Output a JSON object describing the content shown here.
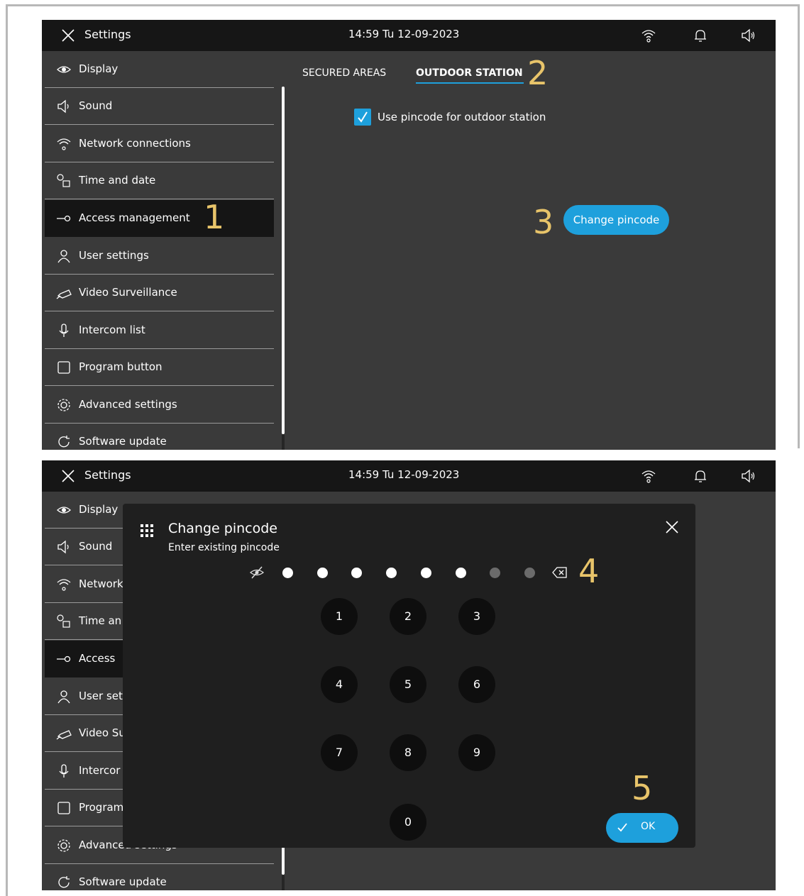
{
  "topbar": {
    "title": "Settings",
    "clock": "14:59  Tu 12-09-2023",
    "icons": [
      "close-icon",
      "wifi-icon",
      "bell-icon",
      "speaker-icon"
    ]
  },
  "sidebar": {
    "items": [
      {
        "label": "Display",
        "icon": "eye-icon"
      },
      {
        "label": "Sound",
        "icon": "speaker-icon"
      },
      {
        "label": "Network connections",
        "icon": "wifi-icon"
      },
      {
        "label": "Time and date",
        "icon": "clock-calendar-icon"
      },
      {
        "label": "Access  management",
        "icon": "key-icon",
        "active": true
      },
      {
        "label": "User settings",
        "icon": "user-icon"
      },
      {
        "label": "Video Surveillance",
        "icon": "camera-icon"
      },
      {
        "label": "Intercom list",
        "icon": "microphone-icon"
      },
      {
        "label": "Program button",
        "icon": "square-icon"
      },
      {
        "label": "Advanced settings",
        "icon": "gear-icon"
      },
      {
        "label": "Software update",
        "icon": "refresh-icon"
      }
    ],
    "items_dialog_view": [
      {
        "label": "Display"
      },
      {
        "label": "Sound"
      },
      {
        "label": "Network"
      },
      {
        "label": "Time an"
      },
      {
        "label": "Access"
      },
      {
        "label": "User set"
      },
      {
        "label": "Video Su"
      },
      {
        "label": "Intercor"
      },
      {
        "label": "Program"
      },
      {
        "label": "Advanced settings"
      },
      {
        "label": "Software update"
      }
    ]
  },
  "main": {
    "tabs": [
      {
        "label": "SECURED AREAS",
        "active": false
      },
      {
        "label": "OUTDOOR STATION",
        "active": true
      }
    ],
    "checkbox": {
      "label": "Use pincode for outdoor station",
      "checked": true
    },
    "change_button": "Change pincode"
  },
  "dialog": {
    "title": "Change pincode",
    "subtitle": "Enter existing pincode",
    "pin_length": 8,
    "pin_entered": 6,
    "keys": [
      "1",
      "2",
      "3",
      "4",
      "5",
      "6",
      "7",
      "8",
      "9",
      "0"
    ],
    "ok_label": "OK"
  },
  "annotations": [
    "1",
    "2",
    "3",
    "4",
    "5"
  ],
  "colors": {
    "accent": "#1ea0dc",
    "topbar": "#161616",
    "background": "#3a3a3a",
    "annotation": "#e8c46a",
    "dialog": "#1f1f1f"
  }
}
